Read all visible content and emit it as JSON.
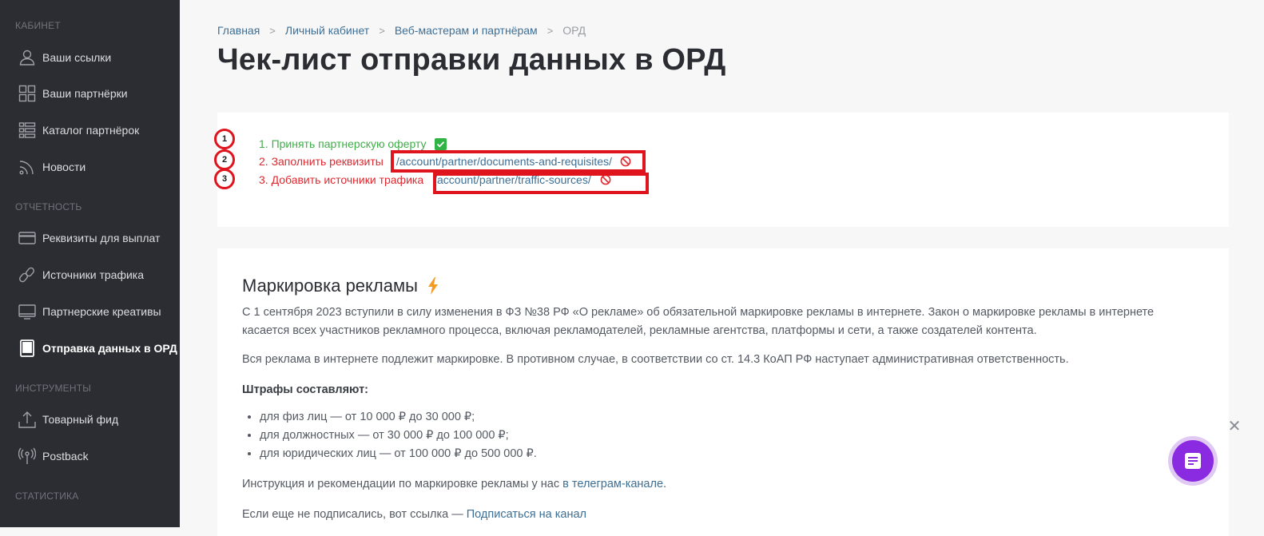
{
  "sidebar": {
    "sections": [
      "КАБИНЕТ",
      "ОТЧЕТНОСТЬ",
      "ИНСТРУМЕНТЫ",
      "СТАТИСТИКА"
    ],
    "items": [
      {
        "label": "Ваши ссылки",
        "icon": "user-icon"
      },
      {
        "label": "Ваши партнёрки",
        "icon": "grid-icon"
      },
      {
        "label": "Каталог партнёрок",
        "icon": "list-icon"
      },
      {
        "label": "Новости",
        "icon": "rss-icon"
      },
      {
        "label": "Реквизиты для выплат",
        "icon": "card-icon"
      },
      {
        "label": "Источники трафика",
        "icon": "link-icon"
      },
      {
        "label": "Партнерские креативы",
        "icon": "monitor-icon"
      },
      {
        "label": "Отправка данных в ОРД",
        "icon": "tablet-icon",
        "active": true
      },
      {
        "label": "Товарный фид",
        "icon": "upload-icon"
      },
      {
        "label": "Postback",
        "icon": "antenna-icon"
      }
    ]
  },
  "breadcrumbs": [
    "Главная",
    "Личный кабинет",
    "Веб-мастерам и партнёрам",
    "ОРД"
  ],
  "page_title": "Чек-лист отправки данных в ОРД",
  "checklist": {
    "markers": [
      "1",
      "2",
      "3"
    ],
    "steps": [
      {
        "text": "1. Принять партнерскую оферту",
        "status": "done"
      },
      {
        "text": "2. Заполнить реквизиты",
        "link": "/account/partner/documents-and-requisites/",
        "status": "missing"
      },
      {
        "text": "3. Добавить источники трафика",
        "link": "/account/partner/traffic-sources/",
        "status": "missing"
      }
    ]
  },
  "marking": {
    "title": "Маркировка рекламы",
    "p1": "С 1 сентября 2023 вступили в силу изменения в ФЗ №38 РФ «О рекламе» об обязательной маркировке рекламы в интернете. Закон о маркировке рекламы в интернете касается всех участников рекламного процесса, включая рекламодателей, рекламные агентства, платформы и сети, а также создателей контента.",
    "p2": "Вся реклама в интернете подлежит маркировке. В противном случае, в соответствии со ст. 14.3 КоАП РФ наступает административная ответственность.",
    "fines_title": "Штрафы составляют:",
    "fines": [
      "для физ лиц — от 10 000 ₽ до 30 000 ₽;",
      "для должностных — от 30 000 ₽ до 100 000 ₽;",
      "для юридических лиц — от 100 000 ₽ до 500 000 ₽."
    ],
    "instr_text": "Инструкция и рекомендации по маркировке рекламы у нас ",
    "instr_link": "в телеграм-канале",
    "instr_end": ".",
    "sub_text": "Если еще не подписались, вот ссылка — ",
    "sub_link": "Подписаться на канал"
  },
  "colors": {
    "sidebar_bg": "#2b2d33",
    "done": "#3fae49",
    "missing": "#e0282e",
    "link": "#3e6f95",
    "chat": "#8a2be2",
    "highlight": "#e0141c"
  }
}
